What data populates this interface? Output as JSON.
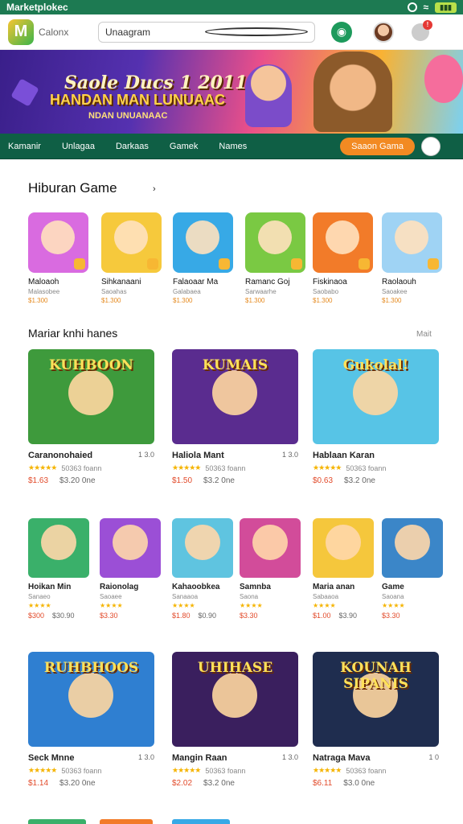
{
  "status": {
    "app_name": "Marketplokec"
  },
  "header": {
    "logo_letter": "M",
    "brand": "Calonx",
    "search_value": "Unaagram"
  },
  "banner": {
    "title": "Saole Ducs 1 2011",
    "subtitle": "HANDAN MAN LUNUAAC",
    "tagline": "NDAN UNUANAAC"
  },
  "nav": {
    "items": [
      "Kamanir",
      "Unlagaa",
      "Darkaas",
      "Gamek",
      "Names"
    ],
    "cta": "Saaon Gama"
  },
  "section1": {
    "title": "Hiburan Game",
    "arrow": "›",
    "items": [
      {
        "name": "Maloaoh",
        "sub": "Malasobee",
        "price": "$1.300",
        "bg": "#d96be0"
      },
      {
        "name": "Sihkanaani",
        "sub": "Saoahas",
        "price": "$1.300",
        "bg": "#f6c93c"
      },
      {
        "name": "Falaoaar Ma",
        "sub": "Galabaea",
        "price": "$1.300",
        "bg": "#37a9e6"
      },
      {
        "name": "Ramanc Goj",
        "sub": "Sarwaarhe",
        "price": "$1.300",
        "bg": "#7ac943"
      },
      {
        "name": "Fiskinaoa",
        "sub": "Saobabo",
        "price": "$1.300",
        "bg": "#f27b29"
      },
      {
        "name": "Raolaouh",
        "sub": "Saoakee",
        "price": "$1.300",
        "bg": "#9fd3f4"
      }
    ]
  },
  "section2": {
    "title": "Mariar knhi hanes",
    "more": "Mait",
    "row1": [
      {
        "name": "Caranonohaied",
        "rank": "1 3.0",
        "count": "50363 foann",
        "price": "$1.63",
        "old": "$3.20 0ne",
        "art": "KUHBOON",
        "bg": "#3e9a3c"
      },
      {
        "name": "Haliola Mant",
        "rank": "1 3.0",
        "count": "50363 foann",
        "price": "$1.50",
        "old": "$3.2 0ne",
        "art": "KUMAIS",
        "bg": "#5a2c8f"
      },
      {
        "name": "Hablaan Karan",
        "rank": "",
        "count": "50363 foann",
        "price": "$0.63",
        "old": "$3.2 0ne",
        "art": "Gukolal!",
        "bg": "#57c4e6"
      }
    ],
    "row2": [
      {
        "name": "Hoikan Min",
        "sub": "Sanaeo",
        "price": "$300",
        "old": "$30.90",
        "bg": "#3ab06a"
      },
      {
        "name": "Raionolag",
        "sub": "Saoaee",
        "price": "$3.30",
        "old": "",
        "bg": "#9b4fd6"
      },
      {
        "name": "Kahaoobkea",
        "sub": "Sanaaoa",
        "price": "$1.80",
        "old": "$0.90",
        "bg": "#5fc4e0"
      },
      {
        "name": "Samnba",
        "sub": "Saona",
        "price": "$3.30",
        "old": "",
        "bg": "#d24c9a"
      },
      {
        "name": "Maria anan",
        "sub": "Sabaaoa",
        "price": "$1.00",
        "old": "$3.90",
        "bg": "#f5c73c"
      },
      {
        "name": "Game",
        "sub": "Saoana",
        "price": "$3.30",
        "old": "",
        "bg": "#3b86c8"
      }
    ],
    "row3": [
      {
        "name": "Seck Mnne",
        "rank": "1 3.0",
        "count": "50363 foann",
        "price": "$1.14",
        "old": "$3.20 0ne",
        "art": "RUHBHOOS",
        "bg": "#2f7fd1"
      },
      {
        "name": "Mangin Raan",
        "rank": "1 3.0",
        "count": "50363 foann",
        "price": "$2.02",
        "old": "$3.2 0ne",
        "art": "UHIHASE",
        "bg": "#3a1f5e"
      },
      {
        "name": "Natraga Mava",
        "rank": "1 0",
        "count": "50363 foann",
        "price": "$6.11",
        "old": "$3.0 0ne",
        "art": "KOUNAH SIPANIS",
        "bg": "#1f2d4f"
      }
    ]
  },
  "colors": {
    "primary": "#0f5f45",
    "accent": "#f28a22",
    "price": "#e24a2a",
    "star": "#f5b400"
  }
}
